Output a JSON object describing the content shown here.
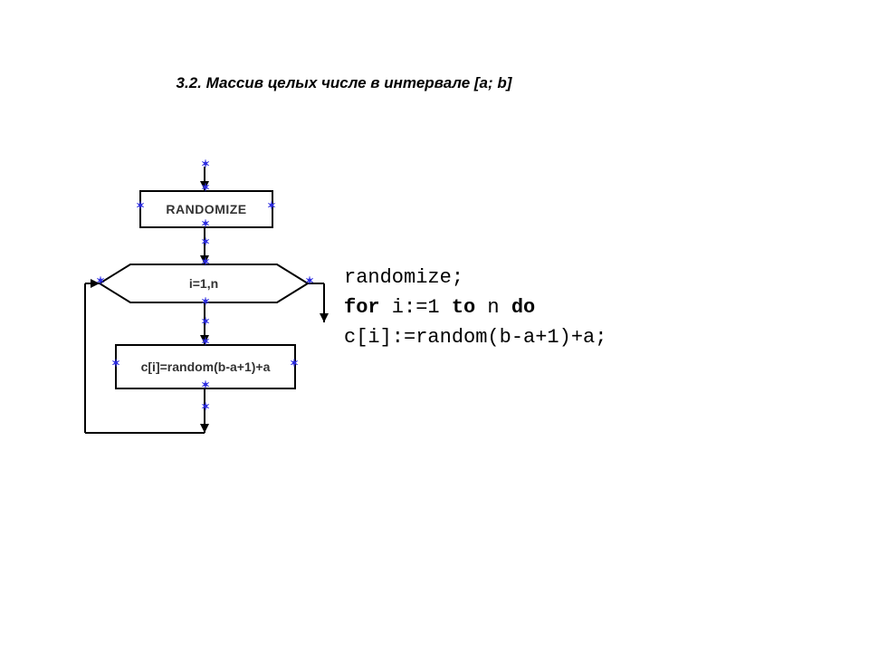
{
  "title": "3.2. Массив целых числе в интервале [a; b]",
  "flow": {
    "randomize": "RANDOMIZE",
    "loop": "i=1,n",
    "assign": "c[i]=random(b-a+1)+a"
  },
  "code": {
    "line1_a": "randomize;",
    "line2_kw1": "for",
    "line2_a": " i:=1 ",
    "line2_kw2": "to",
    "line2_b": " n ",
    "line2_kw3": "do",
    "line3_a": "c[i]:=random(b-a+1)+a;"
  }
}
